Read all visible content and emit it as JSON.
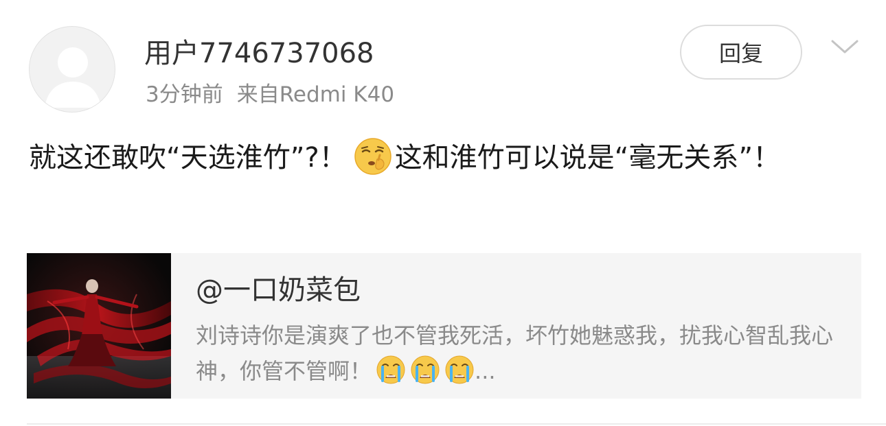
{
  "comment": {
    "avatar_icon": "default-avatar-icon",
    "username": "用户7746737068",
    "time": "3分钟前",
    "source": "来自Redmi K40",
    "reply_label": "回复",
    "menu_icon": "chevron-down-icon",
    "text_part1": "就这还敢吹“天选淮竹”?！",
    "emoji1": "shush-face-emoji",
    "text_part2": "这和淮竹可以说是“毫无关系”！"
  },
  "shared_card": {
    "thumbnail": "dancer-red-silk-image",
    "title": "@一口奶菜包",
    "text": "刘诗诗你是演爽了也不管我死活，坏竹她魅惑我，扰我心智乱我心神，你管不管啊！",
    "emoji": "crying-face-emoji",
    "ellipsis": "..."
  },
  "colors": {
    "background": "#ffffff",
    "username": "#333333",
    "meta": "#8a8a8a",
    "body_text": "#1a1a1a",
    "card_bg": "#f5f5f5",
    "button_border": "#dcdcdc"
  }
}
